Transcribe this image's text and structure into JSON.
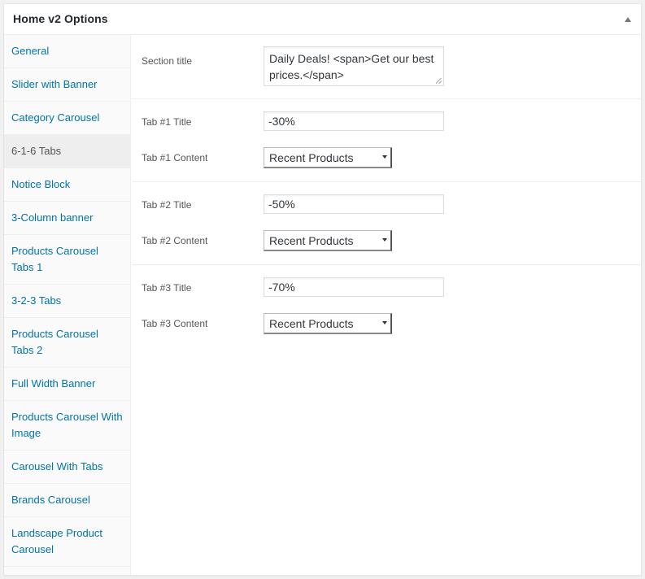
{
  "postbox": {
    "title": "Home v2 Options"
  },
  "tabs": [
    {
      "label": "General"
    },
    {
      "label": "Slider with Banner"
    },
    {
      "label": "Category Carousel"
    },
    {
      "label": "6-1-6 Tabs",
      "active": true
    },
    {
      "label": "Notice Block"
    },
    {
      "label": "3-Column banner"
    },
    {
      "label": "Products Carousel Tabs 1"
    },
    {
      "label": "3-2-3 Tabs"
    },
    {
      "label": "Products Carousel Tabs 2"
    },
    {
      "label": "Full Width Banner"
    },
    {
      "label": "Products Carousel With Image"
    },
    {
      "label": "Carousel With Tabs"
    },
    {
      "label": "Brands Carousel"
    },
    {
      "label": "Landscape Product Carousel"
    }
  ],
  "section": {
    "label": "Section title",
    "value": "Daily Deals! <span>Get our best prices.</span>"
  },
  "tab_fields": [
    {
      "title_label": "Tab #1 Title",
      "title_value": "-30%",
      "content_label": "Tab #1 Content",
      "content_value": "Recent Products"
    },
    {
      "title_label": "Tab #2 Title",
      "title_value": "-50%",
      "content_label": "Tab #2 Content",
      "content_value": "Recent Products"
    },
    {
      "title_label": "Tab #3 Title",
      "title_value": "-70%",
      "content_label": "Tab #3 Content",
      "content_value": "Recent Products"
    }
  ],
  "colors": {
    "link": "#0073aa",
    "active_tab_bg": "#eeeeee",
    "border": "#eeeeee"
  }
}
